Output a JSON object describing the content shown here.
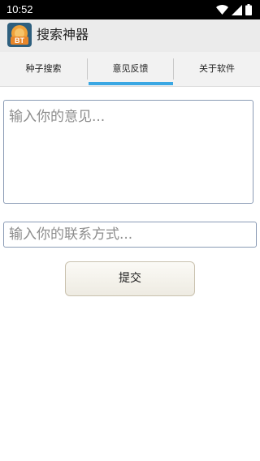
{
  "status_bar": {
    "time": "10:52",
    "icons": [
      "wifi-icon",
      "signal-icon",
      "battery-icon"
    ]
  },
  "app": {
    "title": "搜索神器",
    "icon_text": "BT"
  },
  "tabs": [
    {
      "label": "种子搜索",
      "selected": false
    },
    {
      "label": "意见反馈",
      "selected": true
    },
    {
      "label": "关于软件",
      "selected": false
    }
  ],
  "form": {
    "feedback_placeholder": "输入你的意见...",
    "feedback_value": "",
    "contact_placeholder": "输入你的联系方式...",
    "contact_value": "",
    "submit_label": "提交"
  },
  "colors": {
    "tab_indicator": "#3aa7e3",
    "status_bar": "#000000",
    "action_bar": "#ebebeb"
  }
}
